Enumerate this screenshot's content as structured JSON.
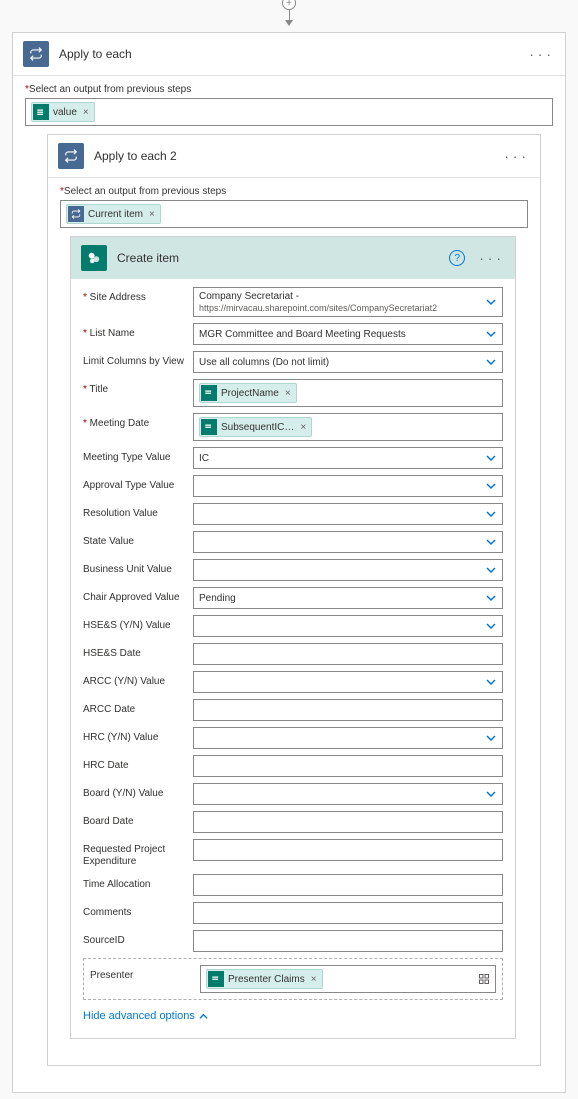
{
  "connector": {
    "plus": "+"
  },
  "outer_loop": {
    "title": "Apply to each",
    "select_label_prefix": "*",
    "select_label": "Select an output from previous steps",
    "token": "value"
  },
  "inner_loop": {
    "title": "Apply to each 2",
    "select_label_prefix": "*",
    "select_label": "Select an output from previous steps",
    "token": "Current item"
  },
  "create_item": {
    "title": "Create item",
    "fields": {
      "site_address": {
        "label": "Site Address",
        "value": "Company Secretariat -",
        "sub": "https://mirvacau.sharepoint.com/sites/CompanySecretariat2",
        "required": true,
        "dropdown": true
      },
      "list_name": {
        "label": "List Name",
        "value": "MGR Committee and Board Meeting Requests",
        "required": true,
        "dropdown": true
      },
      "limit_columns": {
        "label": "Limit Columns by View",
        "value": "Use all columns (Do not limit)",
        "required": false,
        "dropdown": true
      },
      "title": {
        "label": "Title",
        "token": "ProjectName",
        "required": true,
        "dropdown": false
      },
      "meeting_date": {
        "label": "Meeting Date",
        "token": "SubsequentIC…",
        "required": true,
        "dropdown": false
      },
      "meeting_type": {
        "label": "Meeting Type Value",
        "value": "IC",
        "required": false,
        "dropdown": true
      },
      "approval_type": {
        "label": "Approval Type Value",
        "value": "",
        "required": false,
        "dropdown": true
      },
      "resolution": {
        "label": "Resolution Value",
        "value": "",
        "required": false,
        "dropdown": true
      },
      "state": {
        "label": "State Value",
        "value": "",
        "required": false,
        "dropdown": true
      },
      "business_unit": {
        "label": "Business Unit Value",
        "value": "",
        "required": false,
        "dropdown": true
      },
      "chair_approved": {
        "label": "Chair Approved Value",
        "value": "Pending",
        "required": false,
        "dropdown": true
      },
      "hses_yn": {
        "label": "HSE&S (Y/N) Value",
        "value": "",
        "required": false,
        "dropdown": true
      },
      "hses_date": {
        "label": "HSE&S Date",
        "value": "",
        "required": false,
        "dropdown": false
      },
      "arcc_yn": {
        "label": "ARCC (Y/N) Value",
        "value": "",
        "required": false,
        "dropdown": true
      },
      "arcc_date": {
        "label": "ARCC Date",
        "value": "",
        "required": false,
        "dropdown": false
      },
      "hrc_yn": {
        "label": "HRC (Y/N) Value",
        "value": "",
        "required": false,
        "dropdown": true
      },
      "hrc_date": {
        "label": "HRC Date",
        "value": "",
        "required": false,
        "dropdown": false
      },
      "board_yn": {
        "label": "Board (Y/N) Value",
        "value": "",
        "required": false,
        "dropdown": true
      },
      "board_date": {
        "label": "Board Date",
        "value": "",
        "required": false,
        "dropdown": false
      },
      "req_proj_exp": {
        "label": "Requested Project Expenditure",
        "value": "",
        "required": false,
        "dropdown": false
      },
      "time_alloc": {
        "label": "Time Allocation",
        "value": "",
        "required": false,
        "dropdown": false
      },
      "comments": {
        "label": "Comments",
        "value": "",
        "required": false,
        "dropdown": false
      },
      "source_id": {
        "label": "SourceID",
        "value": "",
        "required": false,
        "dropdown": false
      },
      "presenter": {
        "label": "Presenter",
        "token": "Presenter Claims",
        "required": false,
        "dropdown": false
      }
    },
    "advanced_link": "Hide advanced options"
  }
}
